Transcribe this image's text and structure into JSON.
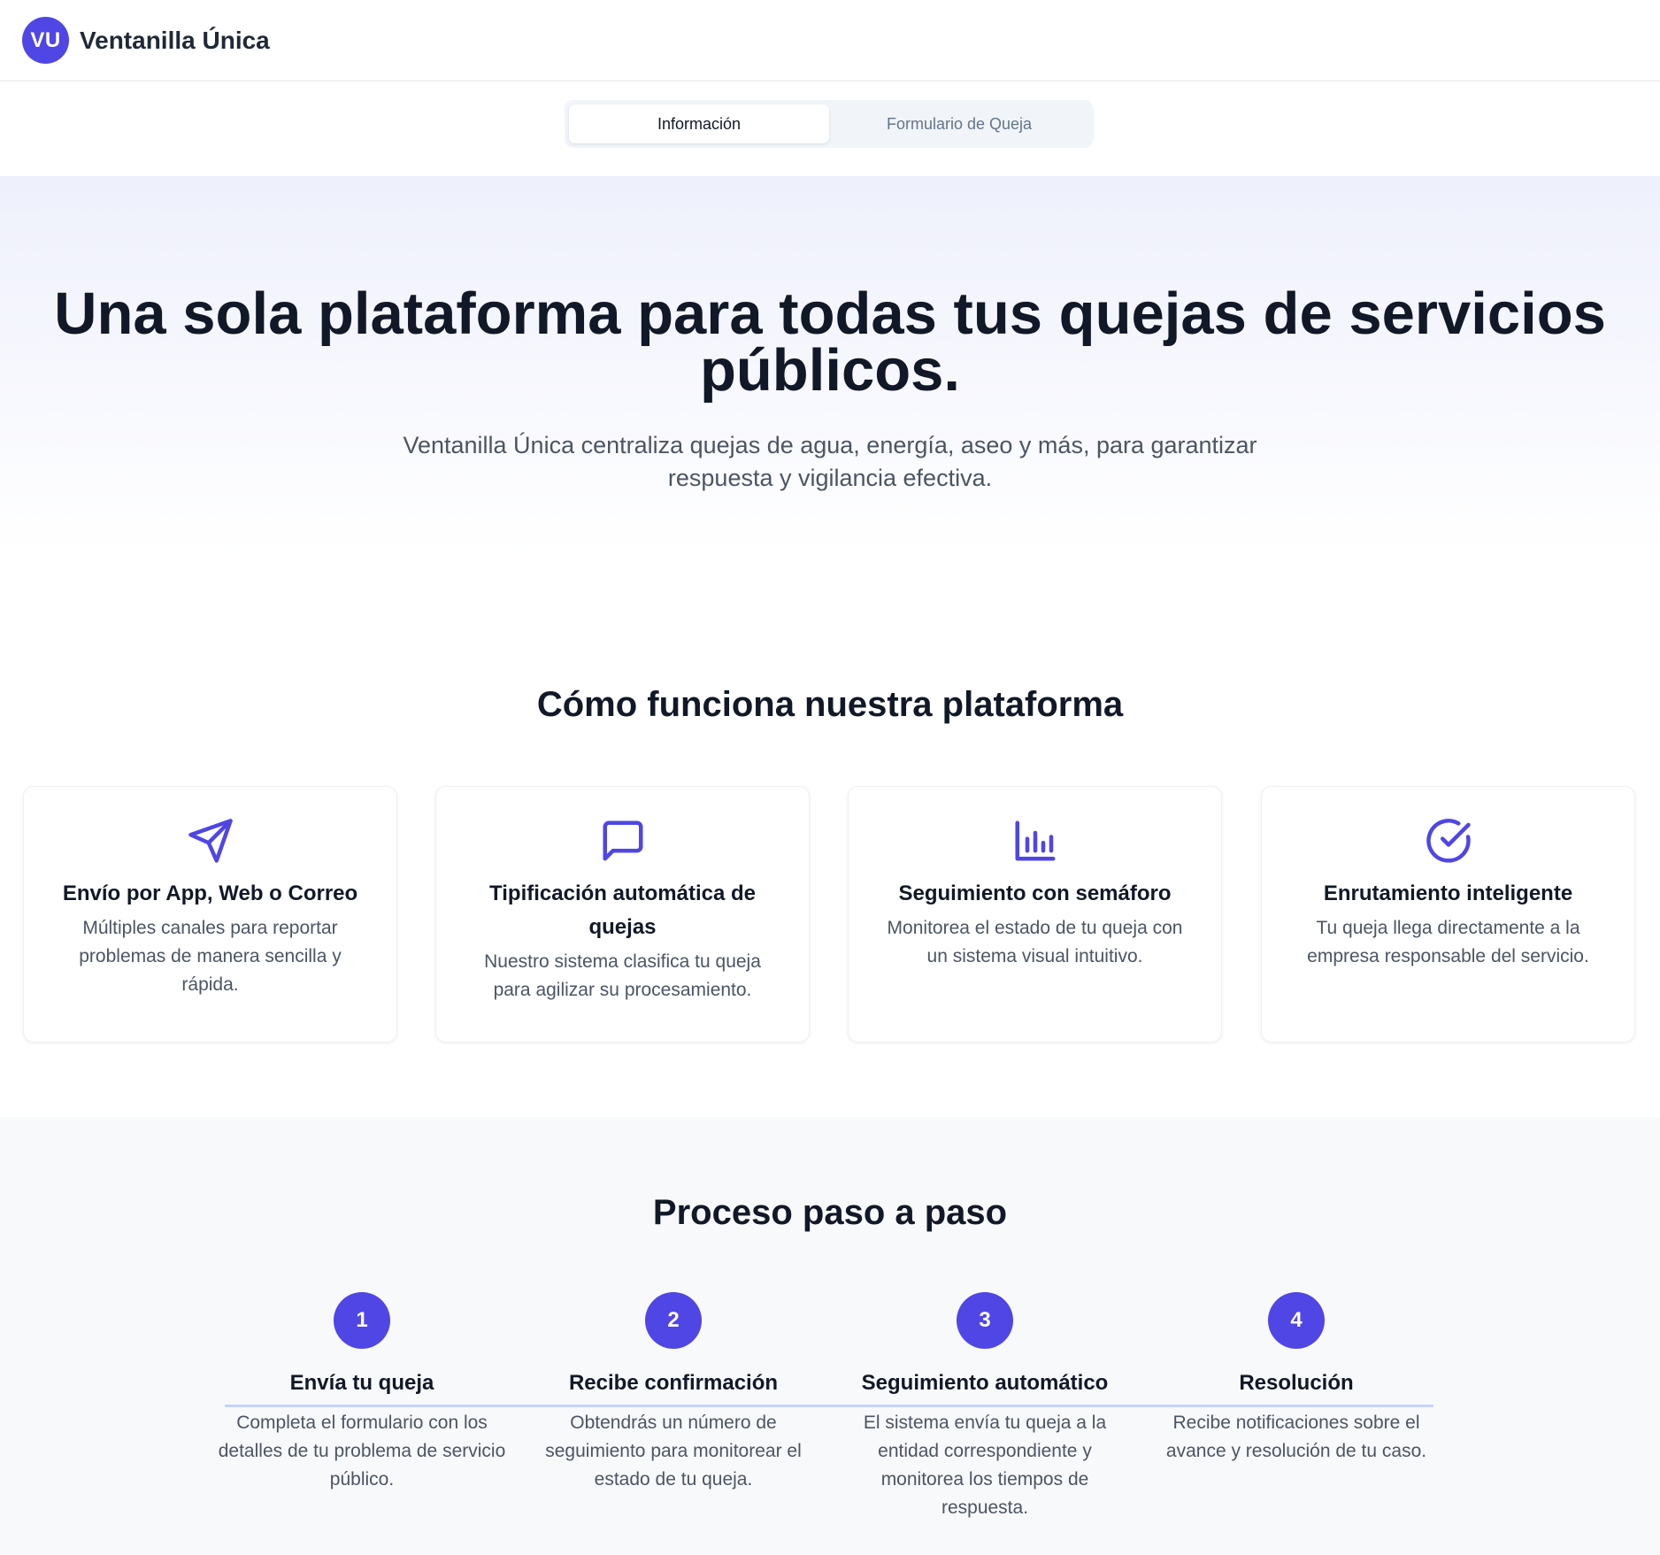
{
  "header": {
    "logo_initials": "VU",
    "app_name": "Ventanilla Única"
  },
  "tabs": [
    {
      "label": "Información",
      "active": true
    },
    {
      "label": "Formulario de Queja",
      "active": false
    }
  ],
  "hero": {
    "title": "Una sola plataforma para todas tus quejas de servicios públicos.",
    "subtitle": "Ventanilla Única centraliza quejas de agua, energía, aseo y más, para garantizar respuesta y vigilancia efectiva."
  },
  "features": {
    "title": "Cómo funciona nuestra plataforma",
    "items": [
      {
        "icon": "send-icon",
        "title": "Envío por App, Web o Correo",
        "text": "Múltiples canales para reportar problemas de manera sencilla y rápida."
      },
      {
        "icon": "message-square-icon",
        "title": "Tipificación automática de quejas",
        "text": "Nuestro sistema clasifica tu queja para agilizar su procesamiento."
      },
      {
        "icon": "bar-chart-icon",
        "title": "Seguimiento con semáforo",
        "text": "Monitorea el estado de tu queja con un sistema visual intuitivo."
      },
      {
        "icon": "check-circle-icon",
        "title": "Enrutamiento inteligente",
        "text": "Tu queja llega directamente a la empresa responsable del servicio."
      }
    ]
  },
  "process": {
    "title": "Proceso paso a paso",
    "steps": [
      {
        "number": "1",
        "title": "Envía tu queja",
        "text": "Completa el formulario con los detalles de tu problema de servicio público."
      },
      {
        "number": "2",
        "title": "Recibe confirmación",
        "text": "Obtendrás un número de seguimiento para monitorear el estado de tu queja."
      },
      {
        "number": "3",
        "title": "Seguimiento automático",
        "text": "El sistema envía tu queja a la entidad correspondiente y monitorea los tiempos de respuesta."
      },
      {
        "number": "4",
        "title": "Resolución",
        "text": "Recibe notificaciones sobre el avance y resolución de tu caso."
      }
    ]
  },
  "colors": {
    "accent": "#4f46e5",
    "timeline": "#c7d2fe",
    "text_primary": "#111827",
    "text_secondary": "#4b5563"
  }
}
